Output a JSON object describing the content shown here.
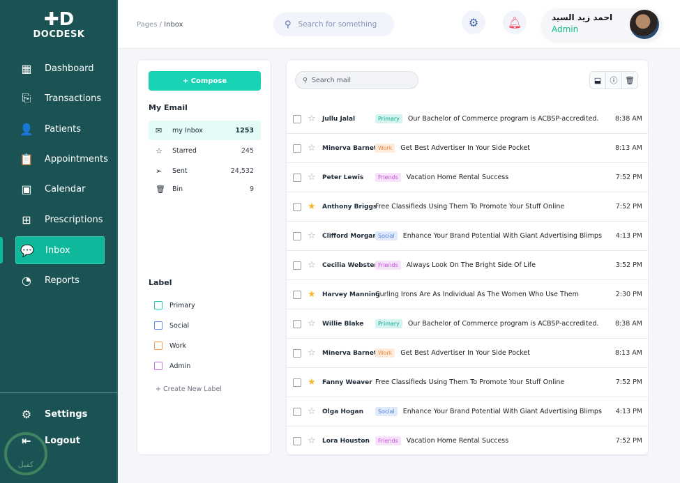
{
  "brand": {
    "name": "DOCDESK",
    "watermark": "كفيل"
  },
  "sidebar": {
    "items": [
      {
        "label": "Dashboard",
        "icon": "dashboard-icon",
        "glyph": "▦"
      },
      {
        "label": "Transactions",
        "icon": "transactions-icon",
        "glyph": "⎘"
      },
      {
        "label": "Patients",
        "icon": "patient-icon",
        "glyph": "👤"
      },
      {
        "label": "Appointments",
        "icon": "clipboard-icon",
        "glyph": "📋"
      },
      {
        "label": "Calendar",
        "icon": "calendar-icon",
        "glyph": "▣"
      },
      {
        "label": "Prescriptions",
        "icon": "prescription-icon",
        "glyph": "⊞"
      },
      {
        "label": "Inbox",
        "icon": "chat-icon",
        "glyph": "💬"
      },
      {
        "label": "Reports",
        "icon": "pie-chart-icon",
        "glyph": "◔"
      }
    ],
    "bottom": [
      {
        "label": "Settings",
        "icon": "gear-icon",
        "glyph": "⚙"
      },
      {
        "label": "Logout",
        "icon": "logout-icon",
        "glyph": "⇤"
      }
    ]
  },
  "header": {
    "breadcrumb_root": "Pages",
    "breadcrumb_current": "Inbox",
    "search_placeholder": "Search for something",
    "user_name": "احمد زيد السيد",
    "user_role": "Admin"
  },
  "folders": {
    "compose": "+ Compose",
    "title": "My Email",
    "items": [
      {
        "label": "my Inbox",
        "count": "1253",
        "glyph": "✉",
        "icon": "mail-icon"
      },
      {
        "label": "Starred",
        "count": "245",
        "glyph": "☆",
        "icon": "star-icon"
      },
      {
        "label": "Sent",
        "count": "24,532",
        "glyph": "➢",
        "icon": "send-icon"
      },
      {
        "label": "Bin",
        "count": "9",
        "glyph": "🗑",
        "icon": "trash-icon"
      }
    ]
  },
  "labels": {
    "title": "Label",
    "items": [
      {
        "label": "Primary",
        "color": "#19c9ac"
      },
      {
        "label": "Social",
        "color": "#5b8def"
      },
      {
        "label": "Work",
        "color": "#f5994d"
      },
      {
        "label": "Admin",
        "color": "#c86ee8"
      }
    ],
    "create": "+   Create New Label"
  },
  "mail": {
    "search_placeholder": "Search mail",
    "tag_colors": {
      "Primary": {
        "fg": "#0ea88f",
        "bg": "#d4f5ef"
      },
      "Work": {
        "fg": "#f5863a",
        "bg": "#fdebdc"
      },
      "Friends": {
        "fg": "#c84fe0",
        "bg": "#f6e3fa"
      },
      "Social": {
        "fg": "#4f7fe0",
        "bg": "#e1eafb"
      }
    },
    "rows": [
      {
        "sender": "Jullu Jalal",
        "tag": "Primary",
        "subject": "Our Bachelor of Commerce program is ACBSP-accredited.",
        "time": "8:38 AM",
        "starred": false
      },
      {
        "sender": "Minerva Barnett",
        "tag": "Work",
        "subject": "Get Best Advertiser In Your Side Pocket",
        "time": "8:13 AM",
        "starred": false
      },
      {
        "sender": "Peter Lewis",
        "tag": "Friends",
        "subject": "Vacation Home Rental Success",
        "time": "7:52 PM",
        "starred": false
      },
      {
        "sender": "Anthony Briggs",
        "tag": "",
        "subject": "Free Classifieds Using Them To Promote Your Stuff Online",
        "time": "7:52 PM",
        "starred": true
      },
      {
        "sender": "Clifford Morgan",
        "tag": "Social",
        "subject": "Enhance Your Brand Potential With Giant Advertising Blimps",
        "time": "4:13 PM",
        "starred": false
      },
      {
        "sender": "Cecilia Webster",
        "tag": "Friends",
        "subject": "Always Look On The Bright Side Of Life",
        "time": "3:52 PM",
        "starred": false
      },
      {
        "sender": "Harvey Manning",
        "tag": "",
        "subject": "Curling Irons Are As Individual As The Women Who Use Them",
        "time": "2:30 PM",
        "starred": true
      },
      {
        "sender": "Willie Blake",
        "tag": "Primary",
        "subject": "Our Bachelor of Commerce program is ACBSP-accredited.",
        "time": "8:38 AM",
        "starred": false
      },
      {
        "sender": "Minerva Barnett",
        "tag": "Work",
        "subject": "Get Best Advertiser In Your Side Pocket",
        "time": "8:13 AM",
        "starred": false
      },
      {
        "sender": "Fanny Weaver",
        "tag": "",
        "subject": "Free Classifieds Using Them To Promote Your Stuff Online",
        "time": "7:52 PM",
        "starred": true
      },
      {
        "sender": "Olga Hogan",
        "tag": "Social",
        "subject": "Enhance Your Brand Potential With Giant Advertising Blimps",
        "time": "4:13 PM",
        "starred": false
      },
      {
        "sender": "Lora Houston",
        "tag": "Friends",
        "subject": "Vacation Home Rental Success",
        "time": "7:52 PM",
        "starred": false
      }
    ]
  }
}
